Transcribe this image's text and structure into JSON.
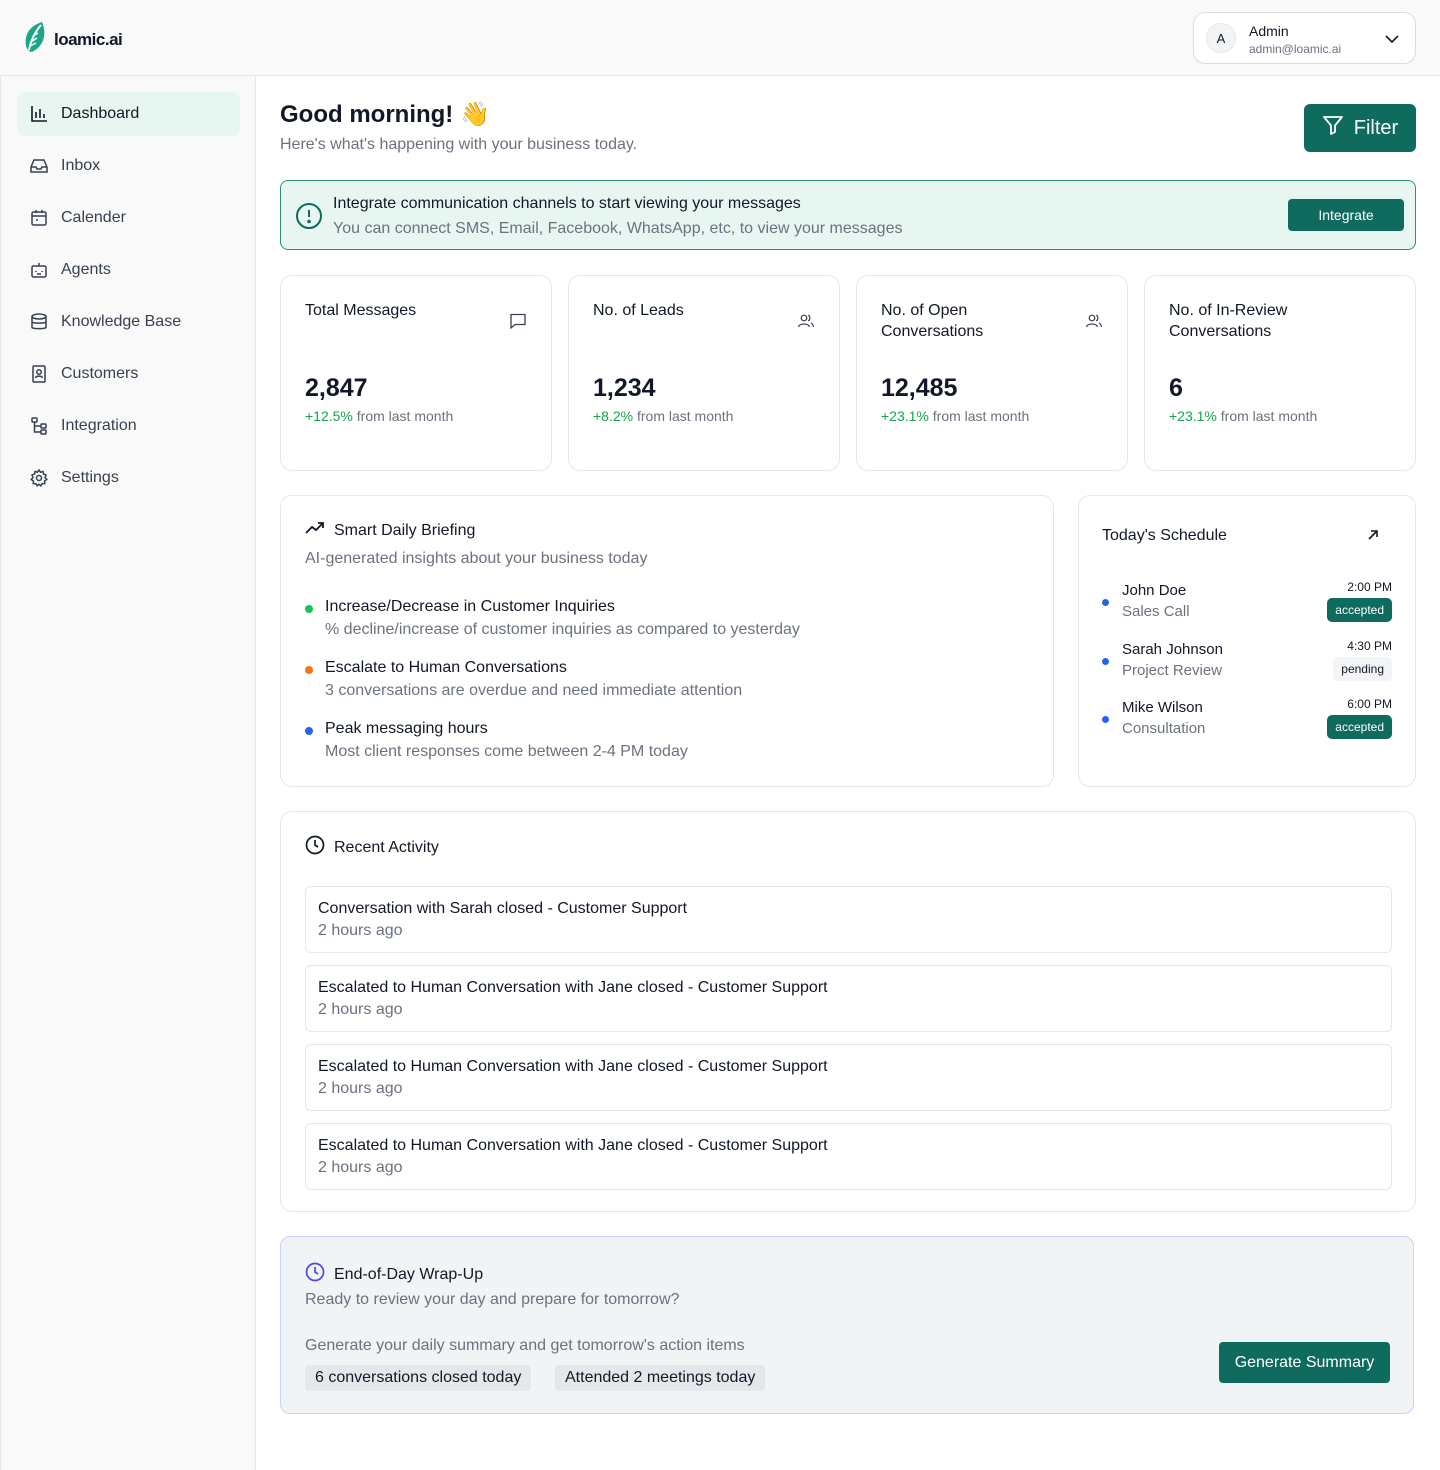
{
  "brand": {
    "name": "loamic.ai",
    "accent": "#0f6b5e"
  },
  "account": {
    "initial": "A",
    "name": "Admin",
    "email": "admin@loamic.ai"
  },
  "sidebar": {
    "items": [
      {
        "label": "Dashboard",
        "icon": "bar-chart-icon",
        "active": true
      },
      {
        "label": "Inbox",
        "icon": "inbox-icon"
      },
      {
        "label": "Calender",
        "icon": "calendar-icon"
      },
      {
        "label": "Agents",
        "icon": "bot-icon"
      },
      {
        "label": "Knowledge Base",
        "icon": "database-icon"
      },
      {
        "label": "Customers",
        "icon": "contact-icon"
      },
      {
        "label": "Integration",
        "icon": "workflow-icon"
      },
      {
        "label": "Settings",
        "icon": "gear-icon"
      }
    ]
  },
  "header": {
    "greeting": "Good morning! 👋",
    "subtitle": "Here's what's happening with your business today.",
    "filter_label": "Filter"
  },
  "banner": {
    "title": "Integrate communication channels to start viewing your messages",
    "text": "You can connect SMS, Email, Facebook, WhatsApp, etc, to view your messages",
    "button": "Integrate"
  },
  "stats": [
    {
      "title": "Total Messages",
      "value": "2,847",
      "change": "+12.5%",
      "suffix": " from last month",
      "icon": "message-icon"
    },
    {
      "title": "No. of Leads",
      "value": "1,234",
      "change": "+8.2%",
      "suffix": " from last month",
      "icon": "users-icon"
    },
    {
      "title": "No. of Open Conversations",
      "value": "12,485",
      "change": "+23.1%",
      "suffix": " from last month",
      "icon": "users-icon"
    },
    {
      "title": "No. of In-Review Conversations",
      "value": "6",
      "change": "+23.1%",
      "suffix": " from last month",
      "icon": ""
    }
  ],
  "briefing": {
    "title": "Smart Daily Briefing",
    "subtitle": "AI-generated insights about your business today",
    "items": [
      {
        "title": "Increase/Decrease in Customer Inquiries",
        "desc": "% decline/increase of customer inquiries as compared to yesterday",
        "color": "#16c45a"
      },
      {
        "title": "Escalate to Human Conversations",
        "desc": "3 conversations are overdue and need immediate attention",
        "color": "#f97316"
      },
      {
        "title": "Peak messaging hours",
        "desc": "Most client responses come between 2-4 PM today",
        "color": "#2563eb"
      }
    ]
  },
  "schedule": {
    "title": "Today's Schedule",
    "items": [
      {
        "name": "John Doe",
        "type": "Sales Call",
        "time": "2:00 PM",
        "status": "accepted"
      },
      {
        "name": "Sarah Johnson",
        "type": "Project Review",
        "time": "4:30 PM",
        "status": "pending"
      },
      {
        "name": "Mike Wilson",
        "type": "Consultation",
        "time": "6:00 PM",
        "status": "accepted"
      }
    ]
  },
  "activity": {
    "title": "Recent Activity",
    "items": [
      {
        "title": "Conversation with Sarah closed - Customer Support",
        "time": "2 hours ago"
      },
      {
        "title": "Escalated to Human Conversation with Jane closed - Customer Support",
        "time": "2 hours ago"
      },
      {
        "title": "Escalated to Human Conversation with Jane closed - Customer Support",
        "time": "2 hours ago"
      },
      {
        "title": "Escalated to Human Conversation with Jane closed - Customer Support",
        "time": "2 hours ago"
      }
    ]
  },
  "wrapup": {
    "title": "End-of-Day Wrap-Up",
    "subtitle": "Ready to review your day and prepare for tomorrow?",
    "prompt": "Generate your daily summary and get tomorrow's action items",
    "chips": [
      "6 conversations closed today",
      "Attended 2 meetings today"
    ],
    "button": "Generate Summary"
  }
}
